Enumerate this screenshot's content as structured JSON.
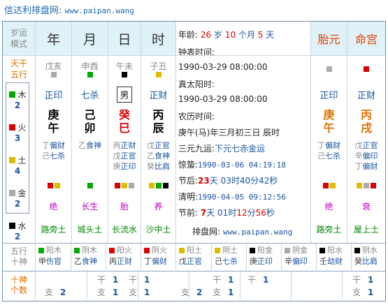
{
  "header": {
    "title": "信达利排盘网:",
    "url": "www.paipan.wang"
  },
  "left_labels": {
    "suiyun": "岁运\n模式",
    "tiangan": "天干\n五行",
    "wuxing_shishen": "五行\n十神",
    "shishen_count": "十神\n个数"
  },
  "pillars": [
    {
      "name": "年",
      "top": "戊亥",
      "sq": [
        "#aaaaaa"
      ],
      "shishen": "正印",
      "gan": "庚",
      "zhi": "午",
      "gan_color": "#000000",
      "zhi_color": "#000000",
      "hidden": [
        [
          "丁",
          "偏财"
        ],
        [
          "己",
          "七杀"
        ]
      ],
      "sq2": [
        "#dd0000",
        "#ddbb00"
      ],
      "state": "绝",
      "nayin": "路旁土"
    },
    {
      "name": "月",
      "top": "申酉",
      "sq": [
        "#00aa00"
      ],
      "shishen": "七杀",
      "gan": "己",
      "zhi": "卯",
      "gan_color": "#000000",
      "zhi_color": "#000000",
      "hidden": [
        [
          "乙",
          "食神"
        ]
      ],
      "sq2": [
        "#00aa00"
      ],
      "state": "长生",
      "nayin": "城头土"
    },
    {
      "name": "日",
      "top": "午未",
      "sq": [
        "#000000"
      ],
      "shishen": "男",
      "gan": "癸",
      "zhi": "巳",
      "gan_color": "#e00000",
      "zhi_color": "#e00000",
      "hidden": [
        [
          "丙",
          "正财"
        ],
        [
          "戊",
          "正官"
        ],
        [
          "庚",
          "正印"
        ]
      ],
      "sq2": [
        "#dd0000",
        "#ddbb00",
        "#aaaaaa"
      ],
      "state": "胎",
      "nayin": "长流水"
    },
    {
      "name": "时",
      "top": "子丑",
      "sq": [
        "#ddbb00"
      ],
      "shishen": "正财",
      "gan": "丙",
      "zhi": "辰",
      "gan_color": "#000000",
      "zhi_color": "#000000",
      "hidden": [
        [
          "戊",
          "正官"
        ],
        [
          "乙",
          "食神"
        ],
        [
          "癸",
          "比肩"
        ]
      ],
      "sq2": [
        "#ddbb00",
        "#00aa00",
        "#000000"
      ],
      "state": "养",
      "nayin": "沙中土"
    }
  ],
  "taiyuan": {
    "name": "胎元",
    "shishen": "正印",
    "gan": "庚",
    "zhi": "午",
    "hidden": [
      [
        "丁",
        "偏财"
      ],
      [
        "己",
        "七杀"
      ]
    ],
    "sq": [
      "#aaaaaa"
    ],
    "sq2": [
      "#dd0000",
      "#ddbb00"
    ],
    "state": "绝",
    "nayin": "路旁土"
  },
  "minggong": {
    "name": "命宫",
    "shishen": "正财",
    "gan": "丙",
    "zhi": "戌",
    "hidden": [
      [
        "戊",
        "正官"
      ],
      [
        "辛",
        "偏印"
      ],
      [
        "丁",
        "偏财"
      ]
    ],
    "sq": [
      "#dd0000"
    ],
    "sq2": [
      "#ddbb00",
      "#aaaaaa",
      "#dd0000"
    ],
    "state": "衰",
    "nayin": "屋上土"
  },
  "wuxing": [
    {
      "name": "木",
      "count": "2",
      "color": "#00aa00"
    },
    {
      "name": "火",
      "count": "3",
      "color": "#dd0000"
    },
    {
      "name": "土",
      "count": "4",
      "color": "#ddbb00"
    },
    {
      "name": "金",
      "count": "2",
      "color": "#aaaaaa"
    },
    {
      "name": "水",
      "count": "2",
      "color": "#000000"
    }
  ],
  "info": {
    "age_label": "年龄:",
    "age": "26",
    "sui": "岁",
    "month": "10",
    "ge_yue": "个月",
    "day": "5",
    "tian": "天",
    "clock_label": "钟表时间:",
    "clock": "1990-03-29 08:00:00",
    "solar_label": "真太阳时:",
    "solar": "1990-03-29 08:00:00",
    "lunar_label": "农历时间:",
    "lunar": "庚午(马)年三月初三日 辰时",
    "sanyuan_label": "三元九运:",
    "sanyuan": "下元七赤金运",
    "jingzhe_label": "惊蛰:",
    "jingzhe": "1990-03-06 04:19:18",
    "jiehou_label": "节后:",
    "jiehou_d": "23",
    "jiehou_rest": "天 03时40分42秒",
    "qingming_label": "清明:",
    "qingming": "1990-04-05 09:12:56",
    "jieqian_label": "节前:",
    "jieqian_d": "7",
    "jieqian_a": "天 01时",
    "jieqian_h": "12",
    "jieqian_b": "分",
    "jieqian_m": "56",
    "jieqian_c": "秒",
    "site_label": "排盘网:",
    "site": "www.paipan.wang"
  },
  "bottom_gan": [
    {
      "wx": "阳木",
      "sq": "#00aa00",
      "gan": "甲",
      "ss": "伤官"
    },
    {
      "wx": "阴木",
      "sq": "#00aa00",
      "gan": "乙",
      "ss": "食神"
    },
    {
      "wx": "阳火",
      "sq": "#dd0000",
      "gan": "丙",
      "ss": "正财"
    },
    {
      "wx": "阴火",
      "sq": "#dd0000",
      "gan": "丁",
      "ss": "偏财"
    },
    {
      "wx": "阳土",
      "sq": "#ddbb00",
      "gan": "戊",
      "ss": "正官"
    },
    {
      "wx": "阴土",
      "sq": "#ddbb00",
      "gan": "己",
      "ss": "七杀"
    },
    {
      "wx": "阳金",
      "sq": "#000000",
      "gan": "庚",
      "ss": "正印"
    },
    {
      "wx": "阴金",
      "sq": "#aaaaaa",
      "gan": "辛",
      "ss": "偏印"
    },
    {
      "wx": "阳水",
      "sq": "#000000",
      "gan": "壬",
      "ss": "劫财"
    },
    {
      "wx": "阴水",
      "sq": "#000000",
      "gan": "癸",
      "ss": "比肩"
    }
  ],
  "bottom_counts": {
    "gan_label": "干",
    "zhi_label": "支",
    "cols": [
      {
        "gan": "",
        "zhi": "2"
      },
      {
        "gan": "1",
        "zhi": "1"
      },
      {
        "gan": "1",
        "zhi": "1"
      },
      {
        "gan": "",
        "zhi": "2"
      },
      {
        "gan": "1",
        "zhi": "1"
      },
      {
        "gan": "1",
        "zhi": ""
      },
      {
        "gan": "1",
        "zhi": "1"
      }
    ]
  }
}
